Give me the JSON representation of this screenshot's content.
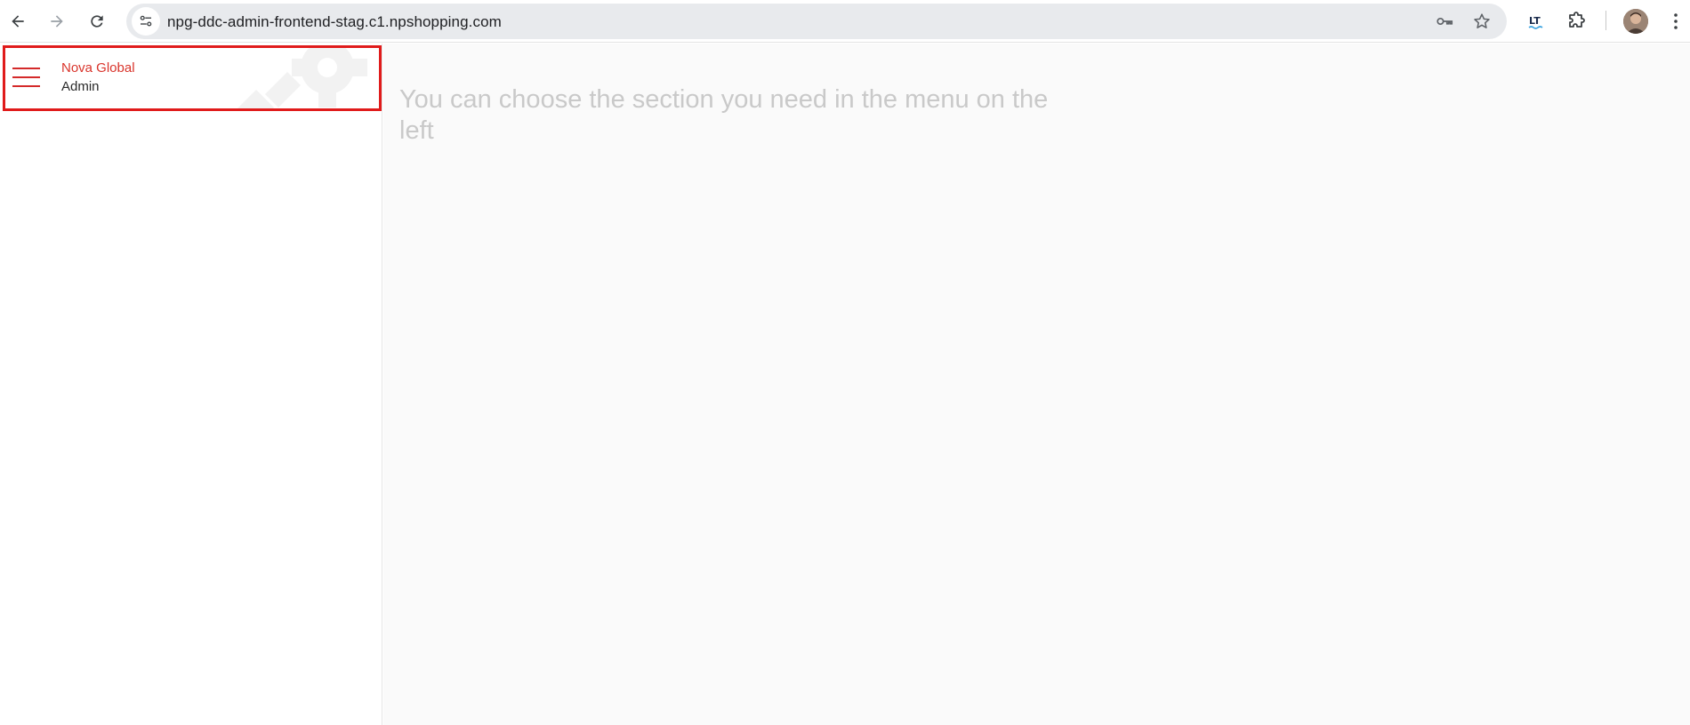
{
  "browser": {
    "url": "npg-ddc-admin-frontend-stag.c1.npshopping.com",
    "icons": {
      "back": "arrow-left-icon",
      "forward": "arrow-right-icon",
      "reload": "reload-icon",
      "site_info": "tune-icon",
      "password": "key-icon",
      "bookmark": "star-icon",
      "extension_lt": "lt-extension-icon",
      "extensions": "puzzle-icon",
      "menu": "more-vertical-icon"
    }
  },
  "sidebar": {
    "brand_name": "Nova Global",
    "brand_sub": "Admin",
    "highlight_color": "#e01b1b"
  },
  "main": {
    "placeholder": "You can choose the section you need in the menu on the left"
  },
  "colors": {
    "brand_red": "#d9342b",
    "placeholder_gray": "#c9c9c9",
    "main_bg": "#fafafa"
  }
}
